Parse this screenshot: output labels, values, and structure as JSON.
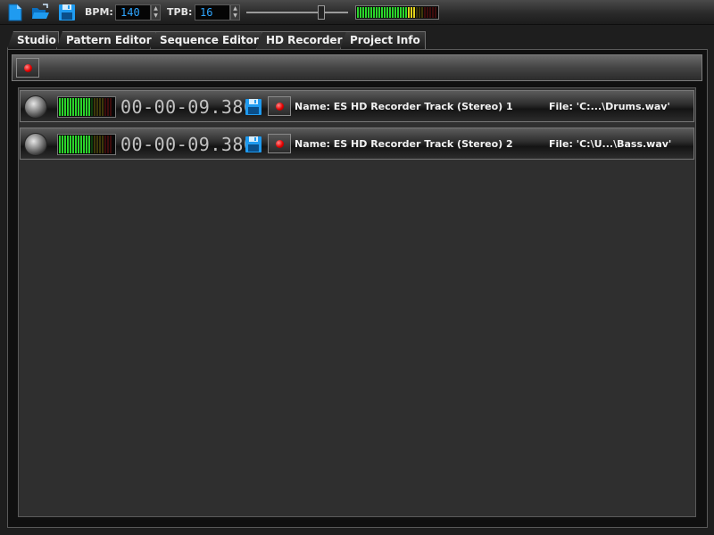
{
  "toolbar": {
    "bpm_label": "BPM:",
    "bpm_value": "140",
    "tpb_label": "TPB:",
    "tpb_value": "16",
    "icons": [
      "new-file-icon",
      "open-folder-icon",
      "save-floppy-icon"
    ],
    "accent_color": "#1f9bf0",
    "master_level": 0.72
  },
  "tabs": [
    {
      "label": "Studio",
      "active": false
    },
    {
      "label": "Pattern Editor",
      "active": false
    },
    {
      "label": "Sequence Editor",
      "active": false
    },
    {
      "label": "HD Recorder",
      "active": true
    },
    {
      "label": "Project Info",
      "active": false
    }
  ],
  "recorder": {
    "tracks": [
      {
        "time": "00-00-09.380",
        "name": "Name: ES HD Recorder Track (Stereo) 1",
        "file": "File: 'C:...\\Drums.wav'",
        "level": 0.6
      },
      {
        "time": "00-00-09.380",
        "name": "Name: ES HD Recorder Track (Stereo) 2",
        "file": "File: 'C:\\U...\\Bass.wav'",
        "level": 0.6
      }
    ]
  }
}
